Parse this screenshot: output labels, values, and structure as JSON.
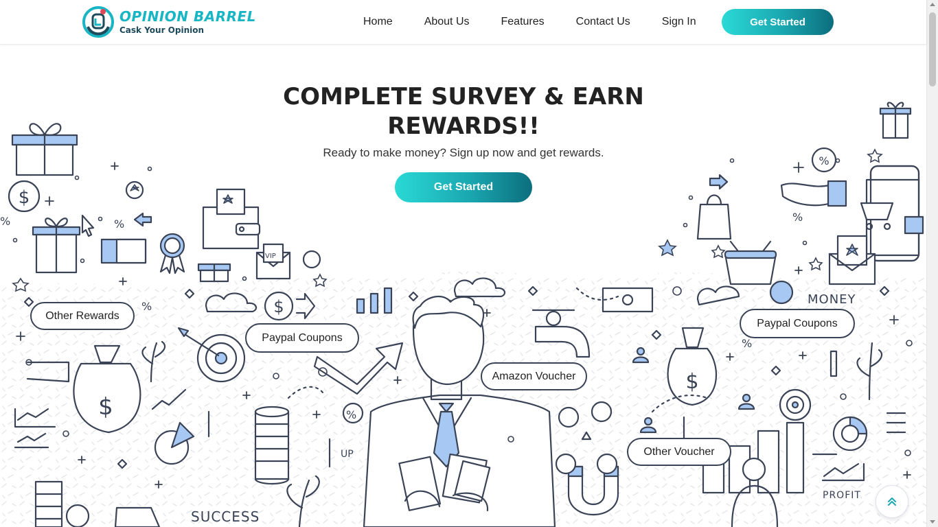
{
  "brand": {
    "name": "OPINION BARREL",
    "tagline": "Cask Your Opinion",
    "accent_color": "#18b6c4",
    "dark_color": "#1d4b5b"
  },
  "nav": {
    "items": [
      {
        "label": "Home"
      },
      {
        "label": "About Us"
      },
      {
        "label": "Features"
      },
      {
        "label": "Contact Us"
      },
      {
        "label": "Sign In"
      }
    ],
    "cta_label": "Get Started"
  },
  "hero": {
    "title_line1": "COMPLETE SURVEY & EARN",
    "title_line2": "REWARDS!!",
    "subtitle": "Ready to make money? Sign up now and get rewards.",
    "cta_label": "Get Started",
    "gradient": [
      "#2ad9d5",
      "#1aa7b0",
      "#0c6e7e"
    ]
  },
  "illustration": {
    "bubbles": [
      {
        "label": "Other Rewards"
      },
      {
        "label": "Paypal Coupons"
      },
      {
        "label": "Amazon Voucher"
      },
      {
        "label": "Paypal Coupons"
      },
      {
        "label": "Other Voucher"
      }
    ],
    "words": {
      "money": "MONEY",
      "success": "SUCCESS",
      "profit": "PROFIT",
      "up": "UP",
      "vip": "VIP"
    },
    "line_color": "#3a4356",
    "highlight_color": "#a7c8f2"
  },
  "back_to_top": {
    "icon": "double-chevron-up-icon"
  }
}
